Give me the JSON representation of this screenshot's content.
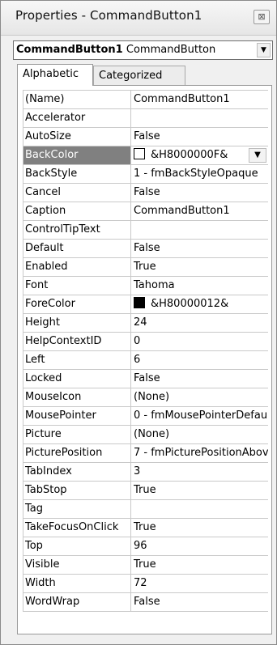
{
  "window": {
    "title": "Properties - CommandButton1",
    "close_glyph": "⊠"
  },
  "object_selector": {
    "name": "CommandButton1",
    "type": "CommandButton",
    "dropdown_icon": "chevron-down-icon"
  },
  "tabs": [
    {
      "label": "Alphabetic",
      "active": true
    },
    {
      "label": "Categorized",
      "active": false
    }
  ],
  "properties": [
    {
      "name": "(Name)",
      "value": "CommandButton1"
    },
    {
      "name": "Accelerator",
      "value": ""
    },
    {
      "name": "AutoSize",
      "value": "False"
    },
    {
      "name": "BackColor",
      "value": "&H8000000F&",
      "swatch": "#ffffff",
      "selected": true
    },
    {
      "name": "BackStyle",
      "value": "1 - fmBackStyleOpaque"
    },
    {
      "name": "Cancel",
      "value": "False"
    },
    {
      "name": "Caption",
      "value": "CommandButton1"
    },
    {
      "name": "ControlTipText",
      "value": ""
    },
    {
      "name": "Default",
      "value": "False"
    },
    {
      "name": "Enabled",
      "value": "True"
    },
    {
      "name": "Font",
      "value": "Tahoma"
    },
    {
      "name": "ForeColor",
      "value": "&H80000012&",
      "swatch": "#000000"
    },
    {
      "name": "Height",
      "value": "24"
    },
    {
      "name": "HelpContextID",
      "value": "0"
    },
    {
      "name": "Left",
      "value": "6"
    },
    {
      "name": "Locked",
      "value": "False"
    },
    {
      "name": "MouseIcon",
      "value": "(None)"
    },
    {
      "name": "MousePointer",
      "value": "0 - fmMousePointerDefaul"
    },
    {
      "name": "Picture",
      "value": "(None)"
    },
    {
      "name": "PicturePosition",
      "value": "7 - fmPicturePositionAbov"
    },
    {
      "name": "TabIndex",
      "value": "3"
    },
    {
      "name": "TabStop",
      "value": "True"
    },
    {
      "name": "Tag",
      "value": ""
    },
    {
      "name": "TakeFocusOnClick",
      "value": "True"
    },
    {
      "name": "Top",
      "value": "96"
    },
    {
      "name": "Visible",
      "value": "True"
    },
    {
      "name": "Width",
      "value": "72"
    },
    {
      "name": "WordWrap",
      "value": "False"
    }
  ],
  "colors": {
    "selected_row_bg": "#808080",
    "grid_line": "#c9c9c9"
  }
}
